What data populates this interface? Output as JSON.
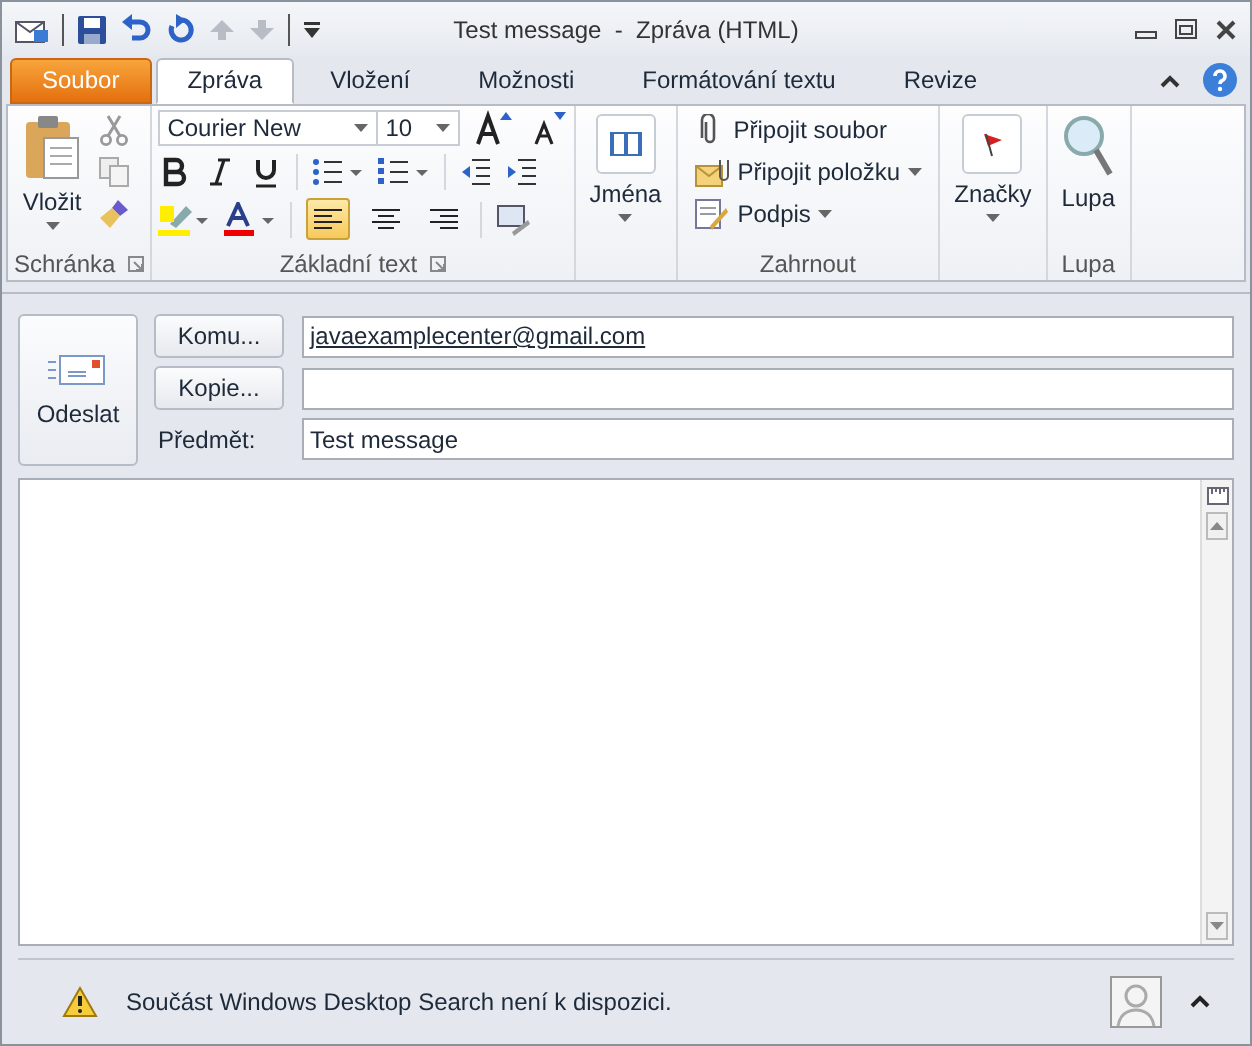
{
  "window": {
    "title": "Test message  -  Zpráva (HTML)"
  },
  "tabs": [
    {
      "label": "Soubor",
      "kind": "file",
      "selected": false
    },
    {
      "label": "Zpráva",
      "kind": "tab",
      "selected": true
    },
    {
      "label": "Vložení",
      "kind": "tab",
      "selected": false
    },
    {
      "label": "Možnosti",
      "kind": "tab",
      "selected": false
    },
    {
      "label": "Formátování textu",
      "kind": "tab",
      "selected": false
    },
    {
      "label": "Revize",
      "kind": "tab",
      "selected": false
    }
  ],
  "ribbon": {
    "clipboard": {
      "paste": "Vložit",
      "label": "Schránka"
    },
    "basic_text": {
      "font": "Courier New",
      "size": "10",
      "label": "Základní text",
      "alignment": [
        {
          "selected": true
        },
        {
          "selected": false
        },
        {
          "selected": false
        }
      ]
    },
    "names": {
      "button": "Jména"
    },
    "include": {
      "items": [
        {
          "label": "Připojit soubor",
          "kind": "file",
          "dropdown": false
        },
        {
          "label": "Připojit položku",
          "kind": "item",
          "dropdown": true
        },
        {
          "label": "Podpis",
          "kind": "signature",
          "dropdown": true
        }
      ],
      "label": "Zahrnout"
    },
    "tags": {
      "button": "Značky"
    },
    "zoom": {
      "button": "Lupa",
      "label": "Lupa"
    }
  },
  "compose": {
    "send": "Odeslat",
    "to_button": "Komu...",
    "to_value": "javaexamplecenter@gmail.com",
    "cc_button": "Kopie...",
    "subject_label": "Předmět:",
    "subject_value": "Test message"
  },
  "status_bar": {
    "message": "Součást Windows Desktop Search není k dispozici."
  }
}
